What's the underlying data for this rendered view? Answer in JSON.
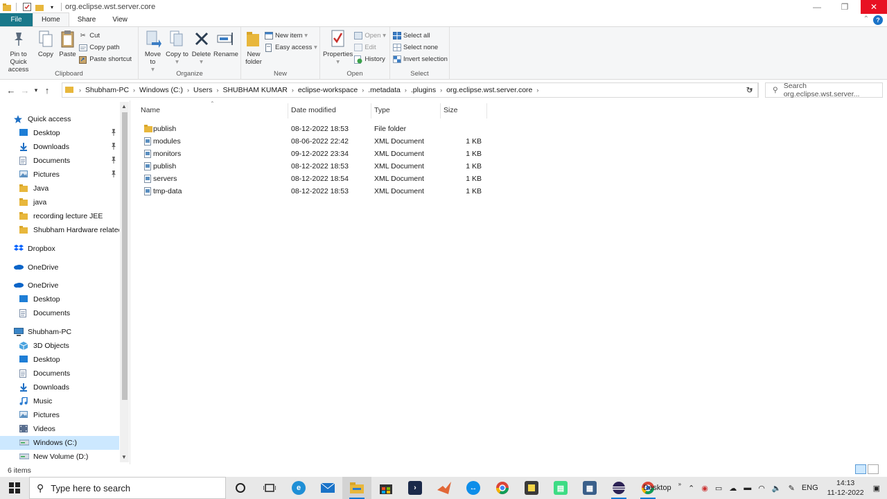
{
  "window": {
    "title": "org.eclipse.wst.server.core"
  },
  "tabs": [
    {
      "label": "File"
    },
    {
      "label": "Home"
    },
    {
      "label": "Share"
    },
    {
      "label": "View"
    }
  ],
  "ribbon": {
    "clipboard": {
      "label": "Clipboard",
      "pin": "Pin to Quick access",
      "copy": "Copy",
      "paste": "Paste",
      "cut": "Cut",
      "copy_path": "Copy path",
      "paste_shortcut": "Paste shortcut"
    },
    "organize": {
      "label": "Organize",
      "move_to": "Move to",
      "copy_to": "Copy to",
      "delete": "Delete",
      "rename": "Rename"
    },
    "new": {
      "label": "New",
      "new_folder": "New folder",
      "new_item": "New item",
      "easy_access": "Easy access"
    },
    "open": {
      "label": "Open",
      "properties": "Properties",
      "open": "Open",
      "edit": "Edit",
      "history": "History"
    },
    "select": {
      "label": "Select",
      "select_all": "Select all",
      "select_none": "Select none",
      "invert": "Invert selection"
    }
  },
  "breadcrumb": [
    "Shubham-PC",
    "Windows (C:)",
    "Users",
    "SHUBHAM KUMAR",
    "eclipse-workspace",
    ".metadata",
    ".plugins",
    "org.eclipse.wst.server.core"
  ],
  "search": {
    "placeholder": "Search org.eclipse.wst.server..."
  },
  "sidebar": {
    "items": [
      {
        "label": "Quick access",
        "icon": "star-icon",
        "color": "#1e6fc4"
      },
      {
        "label": "Desktop",
        "icon": "desktop-icon",
        "color": "#1e7ed6"
      },
      {
        "label": "Downloads",
        "icon": "downloads-icon",
        "color": "#1e6fc4"
      },
      {
        "label": "Documents",
        "icon": "documents-icon",
        "color": "#7a8da8"
      },
      {
        "label": "Pictures",
        "icon": "pictures-icon",
        "color": "#5a8fc0"
      },
      {
        "label": "Java",
        "icon": "folder-icon",
        "color": "#e8b73c"
      },
      {
        "label": "java",
        "icon": "folder-icon",
        "color": "#e8b73c"
      },
      {
        "label": "recording lecture JEE",
        "icon": "folder-icon",
        "color": "#e8b73c"
      },
      {
        "label": "Shubham Hardware related s",
        "icon": "folder-icon",
        "color": "#e8b73c"
      },
      {
        "label": "Dropbox",
        "icon": "dropbox-icon",
        "color": "#0061fe"
      },
      {
        "label": "OneDrive",
        "icon": "onedrive-icon",
        "color": "#0a64c8"
      },
      {
        "label": "OneDrive",
        "icon": "onedrive-icon",
        "color": "#0a64c8"
      },
      {
        "label": "Desktop",
        "icon": "desktop-icon",
        "color": "#1e7ed6"
      },
      {
        "label": "Documents",
        "icon": "documents-icon",
        "color": "#7a8da8"
      },
      {
        "label": "Shubham-PC",
        "icon": "computer-icon",
        "color": "#3a86c8"
      },
      {
        "label": "3D Objects",
        "icon": "3d-objects-icon",
        "color": "#4aa3df"
      },
      {
        "label": "Desktop",
        "icon": "desktop-icon",
        "color": "#1e7ed6"
      },
      {
        "label": "Documents",
        "icon": "documents-icon",
        "color": "#7a8da8"
      },
      {
        "label": "Downloads",
        "icon": "downloads-icon",
        "color": "#1e6fc4"
      },
      {
        "label": "Music",
        "icon": "music-icon",
        "color": "#2a7bd0"
      },
      {
        "label": "Pictures",
        "icon": "pictures-icon",
        "color": "#5a8fc0"
      },
      {
        "label": "Videos",
        "icon": "videos-icon",
        "color": "#5a6f8f"
      },
      {
        "label": "Windows (C:)",
        "icon": "drive-icon",
        "color": "#6c8fb0"
      },
      {
        "label": "New Volume (D:)",
        "icon": "drive-icon",
        "color": "#6c8fb0"
      }
    ]
  },
  "columns": {
    "name": "Name",
    "date": "Date modified",
    "type": "Type",
    "size": "Size"
  },
  "files": [
    {
      "name": "publish",
      "date": "08-12-2022 18:53",
      "type": "File folder",
      "size": ""
    },
    {
      "name": "modules",
      "date": "08-06-2022 22:42",
      "type": "XML Document",
      "size": "1 KB"
    },
    {
      "name": "monitors",
      "date": "09-12-2022 23:34",
      "type": "XML Document",
      "size": "1 KB"
    },
    {
      "name": "publish",
      "date": "08-12-2022 18:53",
      "type": "XML Document",
      "size": "1 KB"
    },
    {
      "name": "servers",
      "date": "08-12-2022 18:54",
      "type": "XML Document",
      "size": "1 KB"
    },
    {
      "name": "tmp-data",
      "date": "08-12-2022 18:53",
      "type": "XML Document",
      "size": "1 KB"
    }
  ],
  "status": {
    "count": "6 items"
  },
  "taskbar": {
    "search_placeholder": "Type here to search",
    "desktop_label": "Desktop",
    "language": "ENG",
    "time": "14:13",
    "date": "11-12-2022"
  }
}
